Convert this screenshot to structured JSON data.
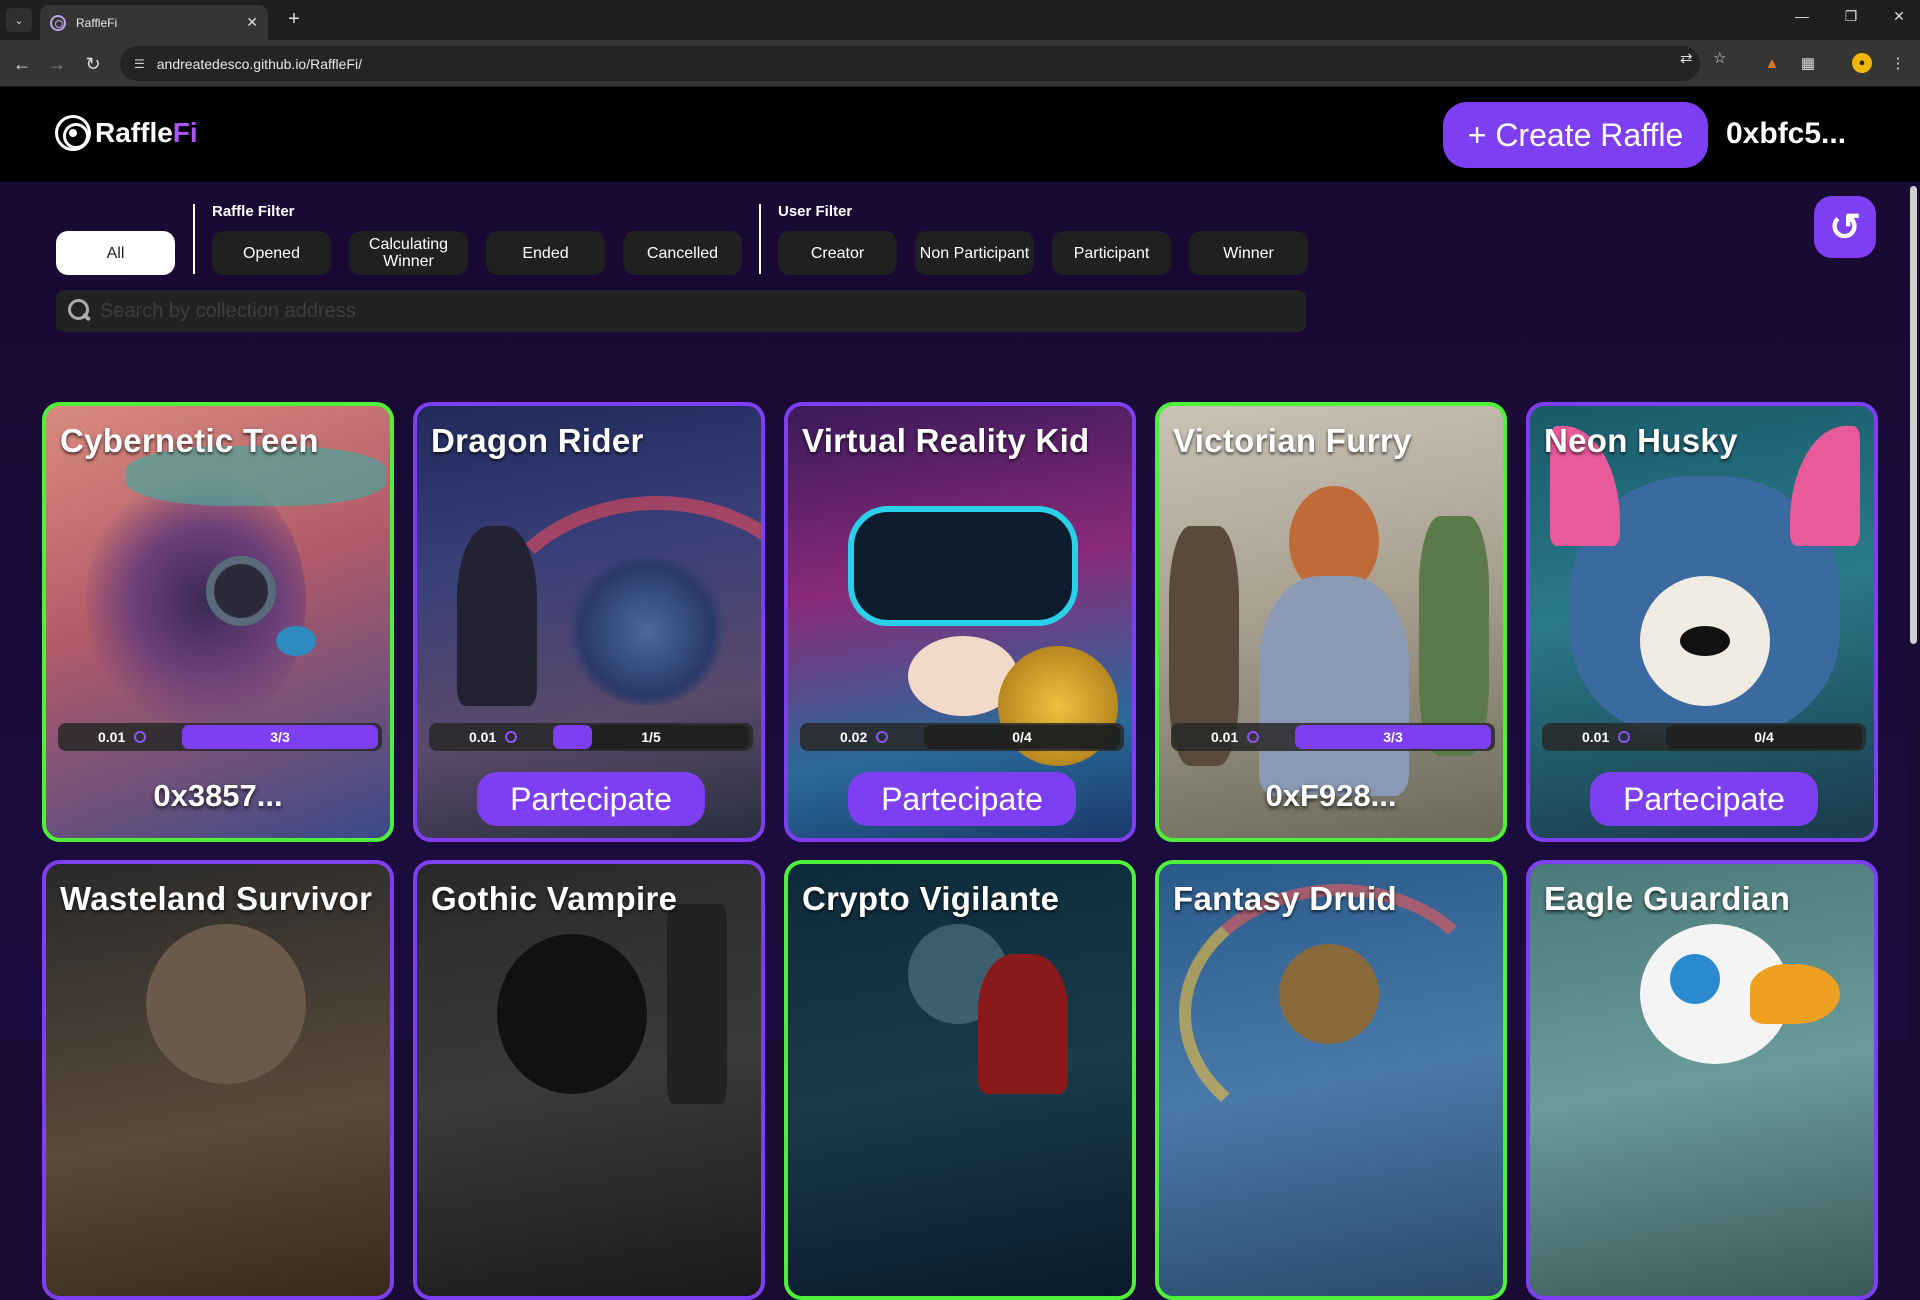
{
  "browser": {
    "tab_title": "RaffleFi",
    "url": "andreatedesco.github.io/RaffleFi/"
  },
  "header": {
    "logo_text_a": "Raffle",
    "logo_text_b": "Fi",
    "create_label": "+ Create Raffle",
    "wallet": "0xbfc5..."
  },
  "filters": {
    "all": "All",
    "raffle_title": "Raffle Filter",
    "raffle": [
      "Opened",
      "Calculating Winner",
      "Ended",
      "Cancelled"
    ],
    "user_title": "User Filter",
    "user": [
      "Creator",
      "Non Participant",
      "Participant",
      "Winner"
    ]
  },
  "search": {
    "placeholder": "Search by collection address"
  },
  "cards": [
    {
      "title": "Cybernetic Teen",
      "price": "0.01",
      "progress": "3/3",
      "fill": 1.0,
      "footer": "0x3857..."
    },
    {
      "title": "Dragon Rider",
      "price": "0.01",
      "progress": "1/5",
      "fill": 0.2,
      "footer": "Partecipate"
    },
    {
      "title": "Virtual Reality Kid",
      "price": "0.02",
      "progress": "0/4",
      "fill": 0,
      "footer": "Partecipate"
    },
    {
      "title": "Victorian Furry",
      "price": "0.01",
      "progress": "3/3",
      "fill": 1.0,
      "footer": "0xF928..."
    },
    {
      "title": "Neon Husky",
      "price": "0.01",
      "progress": "0/4",
      "fill": 0,
      "footer": "Partecipate"
    },
    {
      "title": "Wasteland Survivor"
    },
    {
      "title": "Gothic Vampire"
    },
    {
      "title": "Crypto Vigilante"
    },
    {
      "title": "Fantasy Druid"
    },
    {
      "title": "Eagle Guardian"
    }
  ],
  "colors": {
    "accent": "#7e3ff2",
    "winner_border": "#4ef03a",
    "page_bg": "#1a0b33"
  }
}
